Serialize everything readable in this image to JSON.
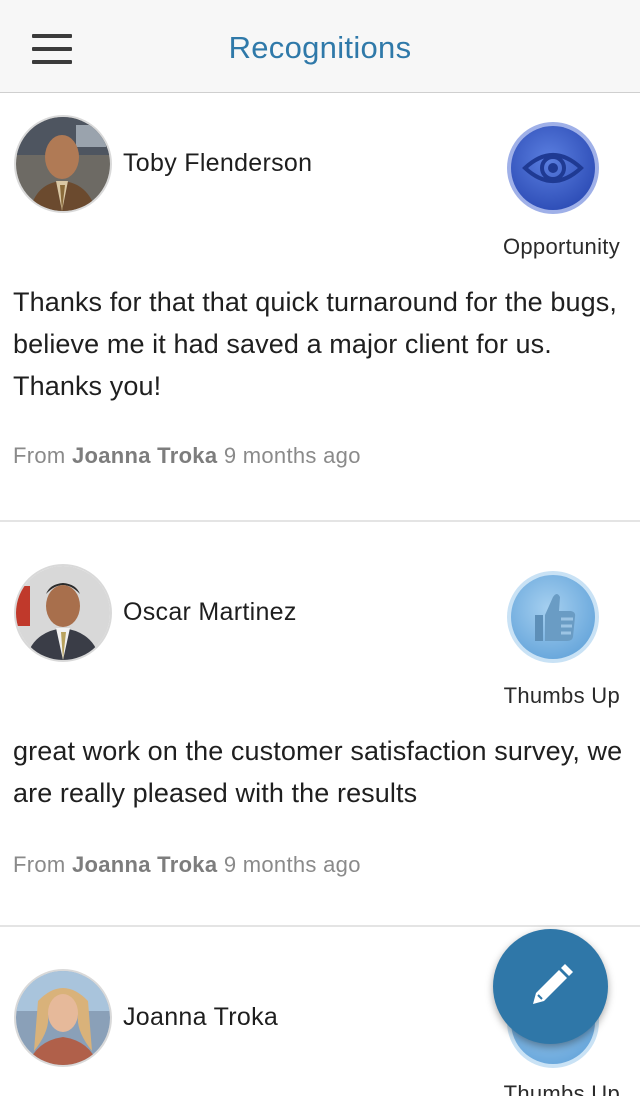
{
  "header": {
    "title": "Recognitions",
    "menu_icon": "hamburger-menu-icon"
  },
  "colors": {
    "accent": "#2f79a9",
    "fab": "#2f77a8",
    "opportunity_badge": "#3b5fc9",
    "thumbs_badge": "#7fb7e3"
  },
  "recognitions": [
    {
      "recipient": "Toby Flenderson",
      "badge_label": "Opportunity",
      "badge_icon": "eye-icon",
      "message": "Thanks for that that quick turnaround for the bugs, believe me it had saved a major client for us. Thanks you!",
      "from_prefix": "From",
      "sender": "Joanna Troka",
      "time": "9 months ago"
    },
    {
      "recipient": "Oscar Martinez",
      "badge_label": "Thumbs Up",
      "badge_icon": "thumbs-up-icon",
      "message": "great work on the customer satisfaction survey, we are really pleased with the results",
      "from_prefix": "From",
      "sender": "Joanna Troka",
      "time": "9 months ago"
    },
    {
      "recipient": "Joanna Troka",
      "badge_label": "Thumbs Up",
      "badge_icon": "thumbs-up-icon"
    }
  ],
  "fab": {
    "icon": "pencil-icon"
  }
}
